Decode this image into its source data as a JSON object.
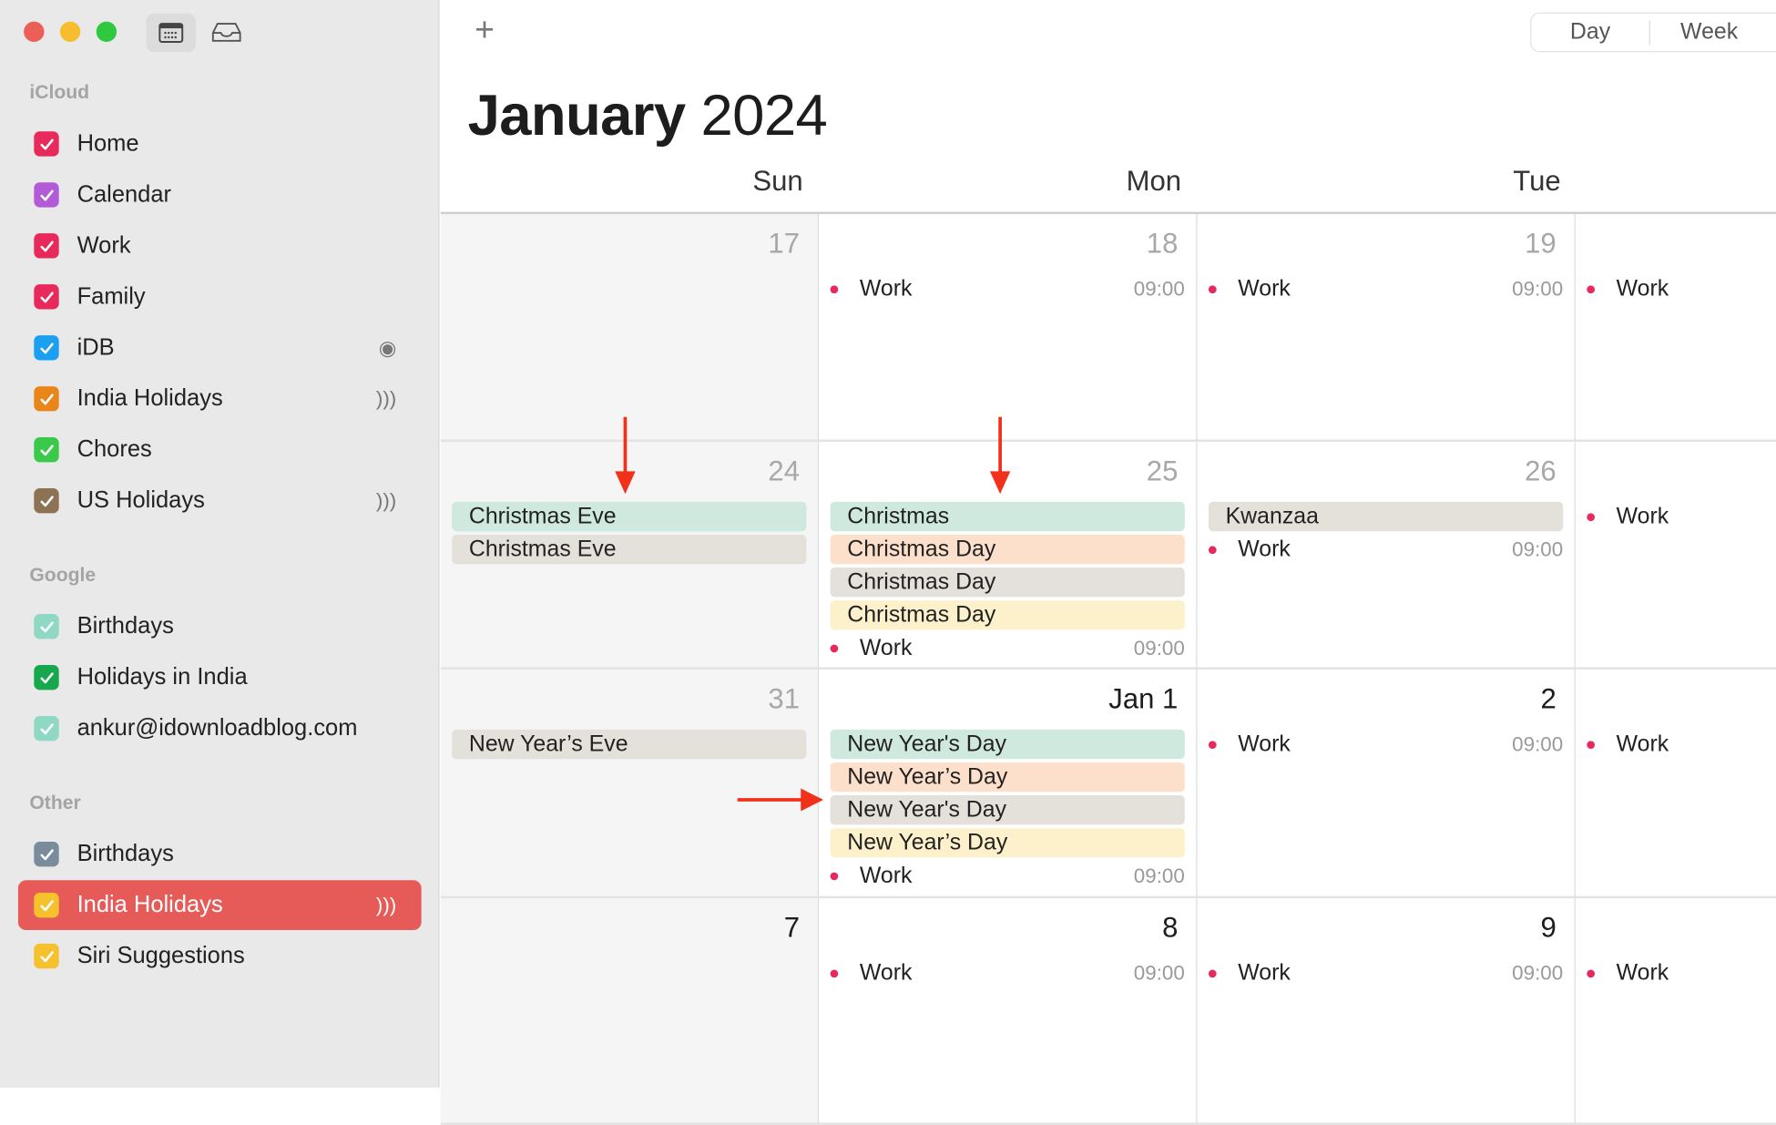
{
  "window": {
    "traffic_lights": [
      "#ec5f57",
      "#f6be2f",
      "#2fc840"
    ]
  },
  "toolbar": {
    "calendar_icon": "calendar-grid-icon",
    "inbox_icon": "inbox-tray-icon",
    "add_label": "+",
    "view_day": "Day",
    "view_week": "Week"
  },
  "header": {
    "month": "January",
    "year": "2024"
  },
  "sidebar": {
    "sections": [
      {
        "title": "iCloud",
        "items": [
          {
            "label": "Home",
            "color": "#e8295b"
          },
          {
            "label": "Calendar",
            "color": "#b35ad6"
          },
          {
            "label": "Work",
            "color": "#e8295b"
          },
          {
            "label": "Family",
            "color": "#e8295b"
          },
          {
            "label": "iDB",
            "color": "#1b9ff0",
            "icon": "person-circle-icon",
            "icon_glyph": "◉"
          },
          {
            "label": "India Holidays",
            "color": "#e8861a",
            "icon": "broadcast-icon",
            "icon_glyph": ")))"
          },
          {
            "label": "Chores",
            "color": "#3ac94a"
          },
          {
            "label": "US Holidays",
            "color": "#8d7253",
            "icon": "broadcast-icon",
            "icon_glyph": ")))"
          }
        ]
      },
      {
        "title": "Google",
        "items": [
          {
            "label": "Birthdays",
            "color": "#8ed8c4"
          },
          {
            "label": "Holidays in India",
            "color": "#17a84e"
          },
          {
            "label": "ankur@idownloadblog.com",
            "color": "#8ed8c4"
          }
        ]
      },
      {
        "title": "Other",
        "items": [
          {
            "label": "Birthdays",
            "color": "#7a8c9c"
          },
          {
            "label": "India Holidays",
            "color": "#f5c12c",
            "icon": "broadcast-icon",
            "icon_glyph": ")))",
            "selected": true
          },
          {
            "label": "Siri Suggestions",
            "color": "#f5c12c"
          }
        ]
      }
    ]
  },
  "days_of_week": [
    "Sun",
    "Mon",
    "Tue"
  ],
  "event_colors": {
    "green": "#cfe9de",
    "orange": "#fde0cc",
    "gray": "#e4e0da",
    "yellow": "#fdf1cc",
    "work_dot": "#e8295b"
  },
  "weeks": [
    {
      "days": [
        {
          "num": "17",
          "current": false,
          "events": []
        },
        {
          "num": "18",
          "current": false,
          "events": [
            {
              "title": "Work",
              "time": "09:00"
            }
          ]
        },
        {
          "num": "19",
          "current": false,
          "events": [
            {
              "title": "Work",
              "time": "09:00"
            }
          ]
        },
        {
          "num": "",
          "events": [
            {
              "title": "Work"
            }
          ]
        }
      ]
    },
    {
      "days": [
        {
          "num": "24",
          "current": false,
          "events": [
            {
              "title": "Christmas Eve",
              "color": "green"
            },
            {
              "title": "Christmas Eve",
              "color": "gray"
            }
          ]
        },
        {
          "num": "25",
          "current": false,
          "events": [
            {
              "title": "Christmas",
              "color": "green"
            },
            {
              "title": "Christmas Day",
              "color": "orange"
            },
            {
              "title": "Christmas Day",
              "color": "gray"
            },
            {
              "title": "Christmas Day",
              "color": "yellow"
            },
            {
              "title": "Work",
              "time": "09:00"
            }
          ]
        },
        {
          "num": "26",
          "current": false,
          "events": [
            {
              "title": "Kwanzaa",
              "color": "gray"
            },
            {
              "title": "Work",
              "time": "09:00"
            }
          ]
        },
        {
          "num": "",
          "events": [
            {
              "title": "Work"
            }
          ]
        }
      ]
    },
    {
      "days": [
        {
          "num": "31",
          "current": false,
          "events": [
            {
              "title": "New Year’s Eve",
              "color": "gray"
            }
          ]
        },
        {
          "num": "Jan 1",
          "current": true,
          "events": [
            {
              "title": "New Year's Day",
              "color": "green"
            },
            {
              "title": "New Year’s Day",
              "color": "orange"
            },
            {
              "title": "New Year's Day",
              "color": "gray"
            },
            {
              "title": "New Year’s Day",
              "color": "yellow"
            },
            {
              "title": "Work",
              "time": "09:00"
            }
          ]
        },
        {
          "num": "2",
          "current": true,
          "events": [
            {
              "title": "Work",
              "time": "09:00"
            }
          ]
        },
        {
          "num": "",
          "events": [
            {
              "title": "Work"
            }
          ]
        }
      ]
    },
    {
      "days": [
        {
          "num": "7",
          "current": true,
          "events": []
        },
        {
          "num": "8",
          "current": true,
          "events": [
            {
              "title": "Work",
              "time": "09:00"
            }
          ]
        },
        {
          "num": "9",
          "current": true,
          "events": [
            {
              "title": "Work",
              "time": "09:00"
            }
          ]
        },
        {
          "num": "",
          "events": [
            {
              "title": "Work"
            }
          ]
        }
      ]
    }
  ],
  "annotation_color": "#f2311b"
}
